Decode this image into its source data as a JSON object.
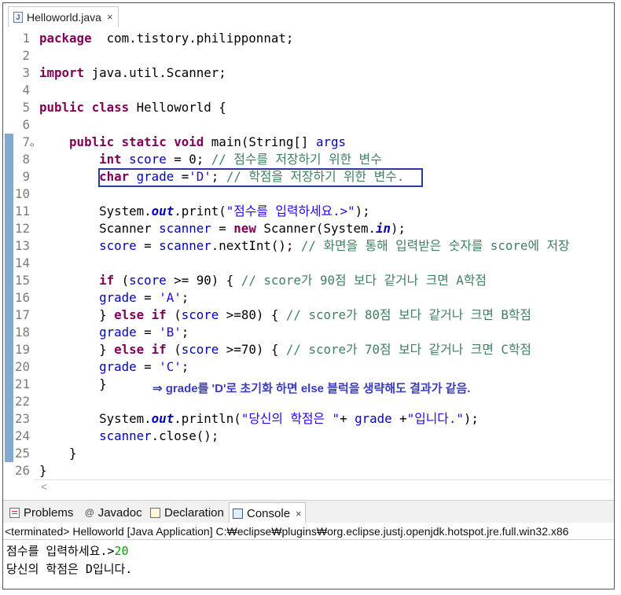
{
  "editor": {
    "tab_label": "Helloworld.java",
    "tab_icon": "java-file-icon",
    "fold_glyph": "⊖",
    "lines": [
      {
        "num": "1",
        "segs": [
          [
            "kw",
            "package"
          ],
          [
            "",
            "  com.tistory.philipponnat;"
          ]
        ]
      },
      {
        "num": "2",
        "segs": []
      },
      {
        "num": "3",
        "segs": [
          [
            "kw",
            "import"
          ],
          [
            "",
            " java.util.Scanner;"
          ]
        ]
      },
      {
        "num": "4",
        "segs": []
      },
      {
        "num": "5",
        "segs": [
          [
            "kw",
            "public"
          ],
          [
            "",
            " "
          ],
          [
            "kw",
            "class"
          ],
          [
            "",
            " Helloworld {"
          ]
        ]
      },
      {
        "num": "6",
        "segs": []
      },
      {
        "num": "7",
        "segs": [
          [
            "",
            "    "
          ],
          [
            "kw",
            "public"
          ],
          [
            "",
            " "
          ],
          [
            "kw",
            "static"
          ],
          [
            "",
            " "
          ],
          [
            "kw",
            "void"
          ],
          [
            "",
            " main(String[] "
          ],
          [
            "vr",
            "args"
          ],
          [
            ") {"
          ]
        ]
      },
      {
        "num": "8",
        "segs": [
          [
            "",
            "        "
          ],
          [
            "kw",
            "int"
          ],
          [
            " ",
            " "
          ],
          [
            "vr",
            "score"
          ],
          [
            "",
            " = 0; "
          ],
          [
            "cm",
            "// 점수를 저장하기 위한 변수"
          ]
        ]
      },
      {
        "num": "9",
        "segs": [
          [
            "",
            "        "
          ],
          [
            "kw",
            "char"
          ],
          [
            "",
            " "
          ],
          [
            "vr",
            "grade"
          ],
          [
            "",
            " ="
          ],
          [
            "st",
            "'D'"
          ],
          [
            "",
            "; "
          ],
          [
            "cm",
            "// 학점을 저장하기 위한 변수."
          ]
        ]
      },
      {
        "num": "10",
        "segs": []
      },
      {
        "num": "11",
        "segs": [
          [
            "",
            "        System."
          ],
          [
            "fld",
            "out"
          ],
          [
            "",
            ".print("
          ],
          [
            "st",
            "\"점수를 입력하세요.>\""
          ],
          [
            "",
            ");"
          ]
        ]
      },
      {
        "num": "12",
        "segs": [
          [
            "",
            "        Scanner "
          ],
          [
            "vr",
            "scanner"
          ],
          [
            "",
            " = "
          ],
          [
            "kw",
            "new"
          ],
          [
            "",
            " Scanner(System."
          ],
          [
            "fld",
            "in"
          ],
          [
            "",
            ");"
          ]
        ]
      },
      {
        "num": "13",
        "segs": [
          [
            "",
            "        "
          ],
          [
            "vr",
            "score"
          ],
          [
            "",
            " = "
          ],
          [
            "vr",
            "scanner"
          ],
          [
            "",
            ".nextInt(); "
          ],
          [
            "cm",
            "// 화면을 통해 입력받은 숫자를 score에 저장"
          ]
        ]
      },
      {
        "num": "14",
        "segs": []
      },
      {
        "num": "15",
        "segs": [
          [
            "",
            "        "
          ],
          [
            "kw",
            "if"
          ],
          [
            "",
            " ("
          ],
          [
            "vr",
            "score"
          ],
          [
            "",
            " >= 90) { "
          ],
          [
            "cm",
            "// score가 90점 보다 같거나 크면 A학점"
          ]
        ]
      },
      {
        "num": "16",
        "segs": [
          [
            "",
            "        "
          ],
          [
            "vr",
            "grade"
          ],
          [
            "",
            " = "
          ],
          [
            "st",
            "'A'"
          ],
          [
            "",
            ";"
          ]
        ]
      },
      {
        "num": "17",
        "segs": [
          [
            "",
            "        } "
          ],
          [
            "kw",
            "else"
          ],
          [
            "",
            " "
          ],
          [
            "kw",
            "if"
          ],
          [
            "",
            " ("
          ],
          [
            "vr",
            "score"
          ],
          [
            "",
            " >=80) { "
          ],
          [
            "cm",
            "// score가 80점 보다 같거나 크면 B학점"
          ]
        ]
      },
      {
        "num": "18",
        "segs": [
          [
            "",
            "        "
          ],
          [
            "vr",
            "grade"
          ],
          [
            "",
            " = "
          ],
          [
            "st",
            "'B'"
          ],
          [
            "",
            ";"
          ]
        ]
      },
      {
        "num": "19",
        "segs": [
          [
            "",
            "        } "
          ],
          [
            "kw",
            "else"
          ],
          [
            "",
            " "
          ],
          [
            "kw",
            "if"
          ],
          [
            "",
            " ("
          ],
          [
            "vr",
            "score"
          ],
          [
            "",
            " >=70) { "
          ],
          [
            "cm",
            "// score가 70점 보다 같거나 크면 C학점"
          ]
        ]
      },
      {
        "num": "20",
        "segs": [
          [
            "",
            "        "
          ],
          [
            "vr",
            "grade"
          ],
          [
            "",
            " = "
          ],
          [
            "st",
            "'C'"
          ],
          [
            "",
            ";"
          ]
        ]
      },
      {
        "num": "21",
        "segs": [
          [
            "",
            "        }"
          ]
        ]
      },
      {
        "num": "22",
        "segs": []
      },
      {
        "num": "23",
        "segs": [
          [
            "",
            "        System."
          ],
          [
            "fld",
            "out"
          ],
          [
            "",
            ".println("
          ],
          [
            "st",
            "\"당신의 학점은 \""
          ],
          [
            "",
            "+ "
          ],
          [
            "vr",
            "grade"
          ],
          [
            "",
            " +"
          ],
          [
            "st",
            "\"입니다.\""
          ],
          [
            "",
            ");"
          ]
        ]
      },
      {
        "num": "24",
        "segs": [
          [
            "",
            "        "
          ],
          [
            "vr",
            "scanner"
          ],
          [
            "",
            ".close();"
          ]
        ]
      },
      {
        "num": "25",
        "segs": [
          [
            "",
            "    }"
          ]
        ]
      },
      {
        "num": "26",
        "segs": [
          [
            "",
            "}"
          ]
        ]
      }
    ],
    "annotation": "⇒ grade를 'D'로 초기화 하면 else 블럭을 생략해도 결과가 같음.",
    "scroll_left": "<"
  },
  "views": {
    "tabs": [
      {
        "label": "Problems",
        "icon": "problems-icon"
      },
      {
        "label": "Javadoc",
        "icon": "javadoc-icon",
        "glyph": "@"
      },
      {
        "label": "Declaration",
        "icon": "declaration-icon"
      },
      {
        "label": "Console",
        "icon": "console-icon",
        "active": true,
        "close": "×"
      }
    ]
  },
  "console": {
    "header": "<terminated> Helloworld [Java Application] C:₩eclipse₩plugins₩org.eclipse.justj.openjdk.hotspot.jre.full.win32.x86",
    "line1_prompt": "점수를 입력하세요.>",
    "line1_input": "20",
    "line2": "당신의 학점은 D입니다."
  },
  "colors": {
    "keyword": "#7f0055",
    "comment": "#3f7f5f",
    "string": "#2a00ff",
    "variable": "#0000c0",
    "annotation": "#3b3bbd",
    "console_input": "#00a000"
  }
}
